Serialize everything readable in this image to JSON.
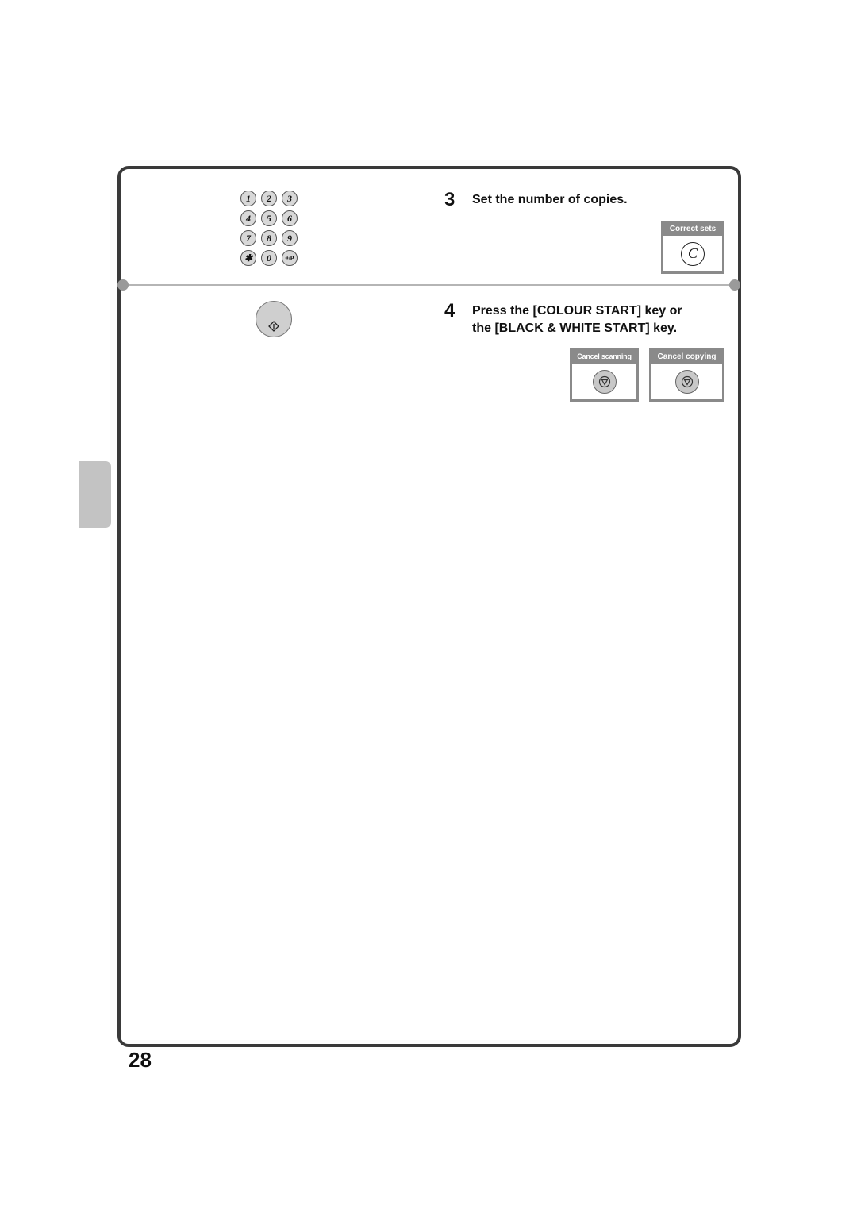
{
  "keypad": {
    "keys": [
      "1",
      "2",
      "3",
      "4",
      "5",
      "6",
      "7",
      "8",
      "9",
      "✱",
      "0",
      "#/P"
    ]
  },
  "steps": [
    {
      "number": "3",
      "text": "Set the number of copies."
    },
    {
      "number": "4",
      "line1": "Press the [COLOUR START] key or",
      "line2": "the [BLACK & WHITE START] key."
    }
  ],
  "buttons": {
    "correct_sets": {
      "label": "Correct sets",
      "key": "C"
    },
    "cancel_scanning": {
      "label": "Cancel scanning"
    },
    "cancel_copying": {
      "label": "Cancel copying"
    }
  },
  "page_number": "28"
}
